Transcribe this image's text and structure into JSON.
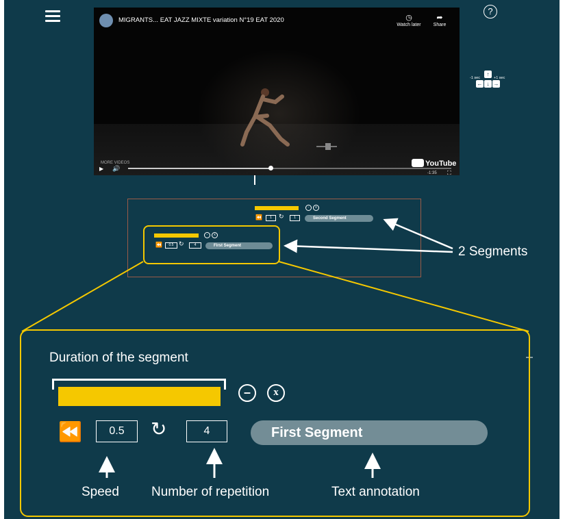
{
  "video": {
    "title": "MIGRANTS... EAT JAZZ MIXTE variation N°19 EAT 2020",
    "watch_later_label": "Watch later",
    "share_label": "Share",
    "more_videos_label": "MORE VIDEOS",
    "youtube_label": "YouTube",
    "time_label": "-1:35",
    "progress_fraction": 0.44
  },
  "header": {
    "menu_icon": "hamburger-menu-icon",
    "help_glyph": "?"
  },
  "keys": {
    "minus_label": "-1 sec",
    "plus_label": "+1 sec"
  },
  "mini_segments": [
    {
      "speed": "1",
      "repetitions": "1",
      "annotation": "Second Segment"
    },
    {
      "speed": "0.5",
      "repetitions": "4",
      "annotation": "First Segment"
    }
  ],
  "callout": {
    "segments_label": "2 Segments"
  },
  "zoom": {
    "duration_title": "Duration of the segment",
    "speed_value": "0.5",
    "repetition_value": "4",
    "annotation_value": "First Segment",
    "minus_glyph": "–",
    "close_glyph": "x",
    "speed_caption": "Speed",
    "repetition_caption": "Number of repetition",
    "annotation_caption": "Text annotation"
  },
  "colors": {
    "background": "#0f3a4a",
    "accent": "#f5c800",
    "panel_border": "#9a5b48",
    "pill": "#738d96"
  }
}
